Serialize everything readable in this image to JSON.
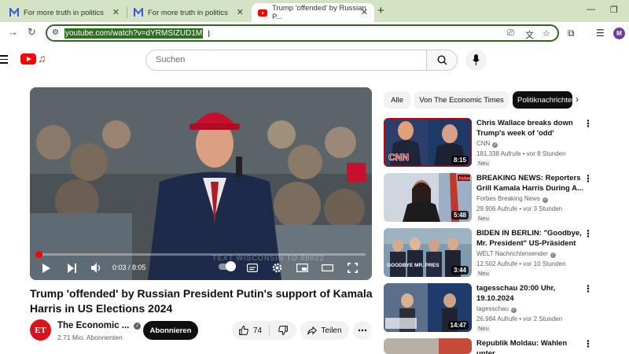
{
  "browser": {
    "tabs": [
      {
        "title": "For more truth in politics"
      },
      {
        "title": "For more truth in politics"
      },
      {
        "title": "Trump 'offended' by Russian P..."
      }
    ],
    "url": "youtube.com/watch?v=dYRMSIZUD1M"
  },
  "header": {
    "search_placeholder": "Suchen"
  },
  "player": {
    "time": "0:03 / 8:05",
    "progress_fraction": 0.006,
    "watermark": "TEXT WISCONSIN TO 88022"
  },
  "video": {
    "title": "Trump 'offended' by Russian President Putin's support of Kamala Harris in US Elections 2024",
    "channel_name": "The Economic ...",
    "channel_initials": "ET",
    "subscribers": "2,71 Mio. Abonnenten",
    "subscribe_label": "Abonnieren",
    "likes": "74",
    "share_label": "Teilen"
  },
  "chips": [
    {
      "label": "Alle"
    },
    {
      "label": "Von The Economic Times"
    },
    {
      "label": "Politiknachrichten"
    }
  ],
  "recommendations": [
    {
      "title": "Chris Wallace breaks down Trump's week of 'odd' actions...",
      "channel": "CNN",
      "views": "181.338 Aufrufe",
      "age": "vor 8 Stunden",
      "badge": "Neu",
      "duration": "8:15"
    },
    {
      "title": "BREAKING NEWS: Reporters Grill Kamala Harris During A...",
      "channel": "Forbes Breaking News",
      "views": "29.906 Aufrufe",
      "age": "vor 3 Stunden",
      "badge": "Neu",
      "duration": "5:48"
    },
    {
      "title": "BIDEN IN BERLIN: \"Goodbye, Mr. President\" US-Präsident trifft...",
      "channel": "WELT Nachrichtensender",
      "views": "12.502 Aufrufe",
      "age": "vor 10 Stunden",
      "badge": "Neu",
      "duration": "3:44",
      "thumb_text": "GOODBYE MR. PRES"
    },
    {
      "title": "tagesschau 20:00 Uhr, 19.10.2024",
      "channel": "tagesschau",
      "views": "26.984 Aufrufe",
      "age": "vor 2 Stunden",
      "badge": "Neu",
      "duration": "14:47"
    },
    {
      "title": "Republik Moldau: Wahlen unter"
    }
  ]
}
